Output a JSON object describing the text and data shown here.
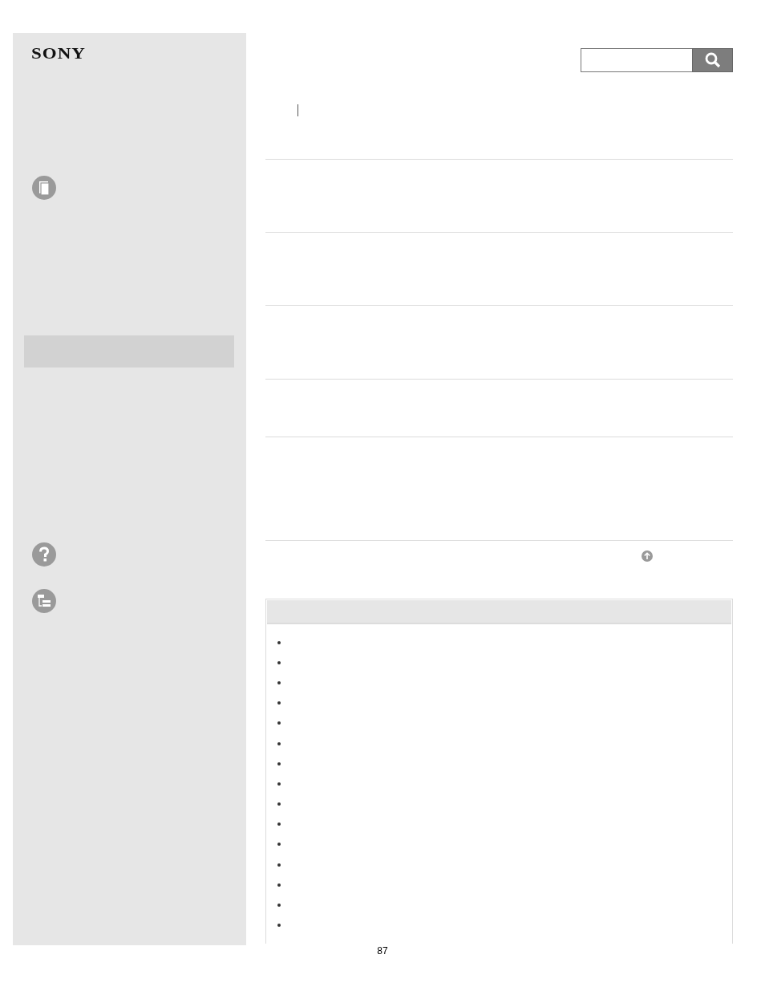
{
  "logo": "SONY",
  "sidebar": {
    "items": [
      {
        "selected": true
      }
    ]
  },
  "bullets": [
    {
      "kind": "bullet"
    },
    {
      "kind": "bullet"
    },
    {
      "kind": "bullet"
    },
    {
      "kind": "bullet"
    },
    {
      "kind": "bullet"
    },
    {
      "kind": "bullet"
    },
    {
      "kind": "bullet"
    },
    {
      "kind": "bullet"
    },
    {
      "kind": "bullet"
    },
    {
      "kind": "bullet"
    },
    {
      "kind": "bullet"
    },
    {
      "kind": "bullet"
    },
    {
      "kind": "bullet"
    },
    {
      "kind": "bullet"
    },
    {
      "kind": "bullet"
    }
  ],
  "page_number": "87"
}
